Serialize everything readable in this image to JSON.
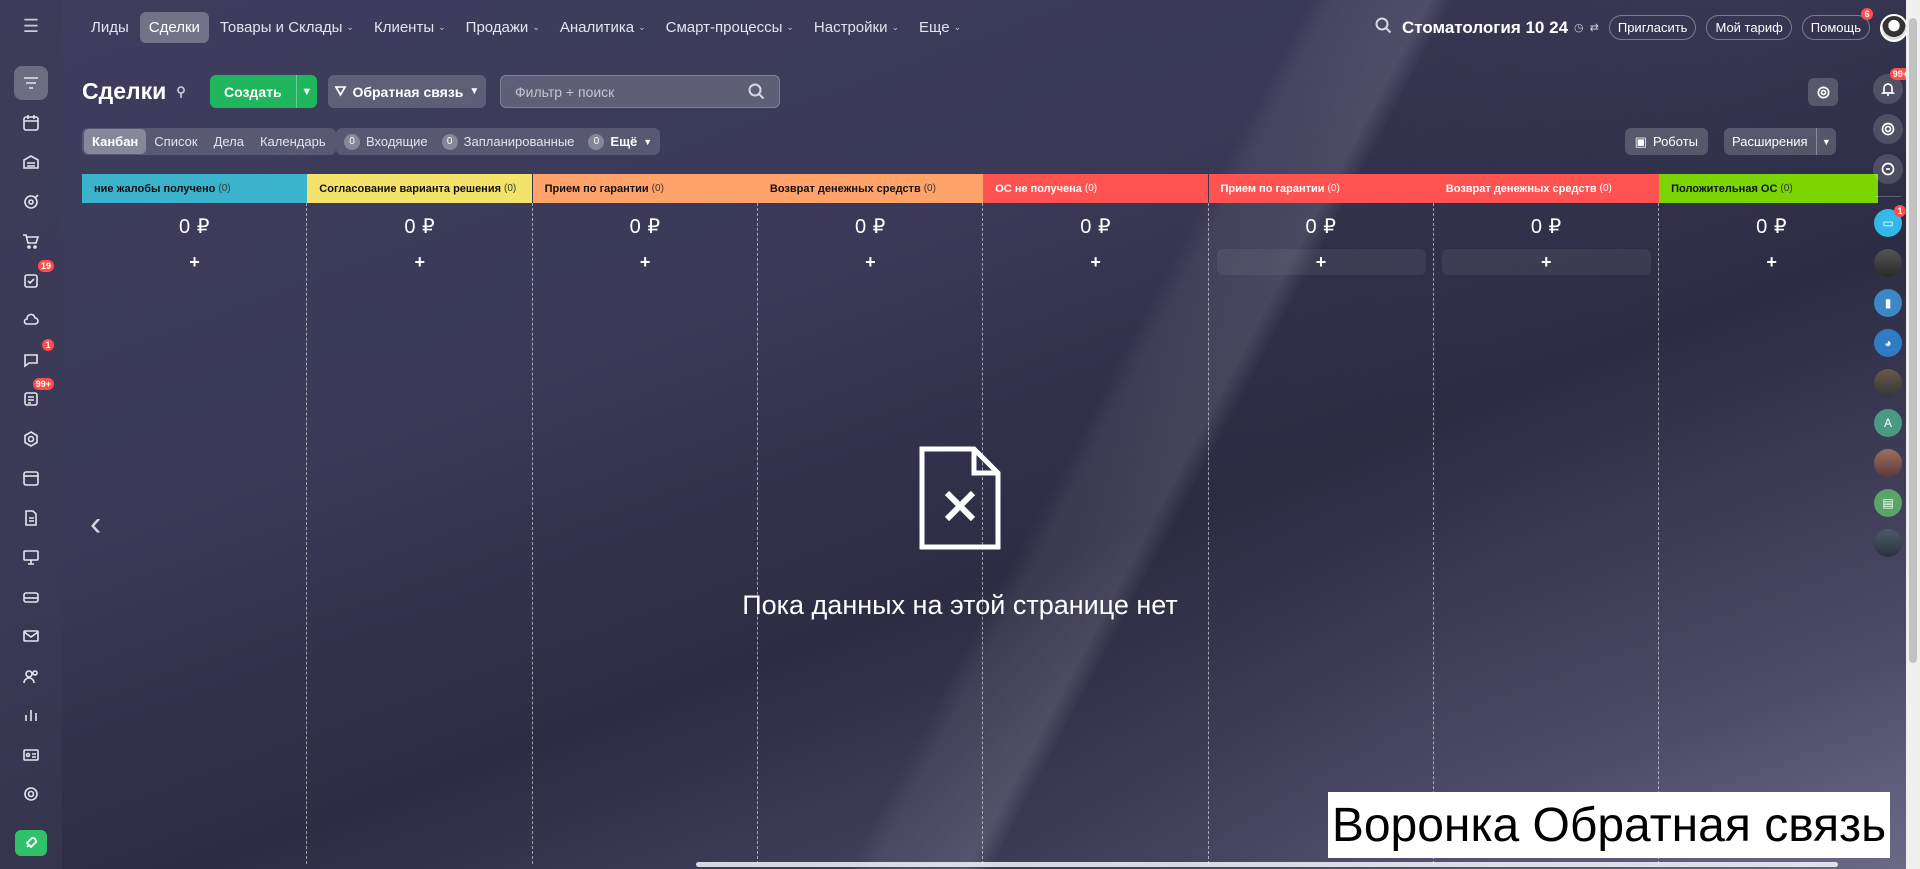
{
  "nav": {
    "items": [
      {
        "label": "Лиды",
        "has_menu": false,
        "active": false
      },
      {
        "label": "Сделки",
        "has_menu": false,
        "active": true
      },
      {
        "label": "Товары и Склады",
        "has_menu": true,
        "active": false
      },
      {
        "label": "Клиенты",
        "has_menu": true,
        "active": false
      },
      {
        "label": "Продажи",
        "has_menu": true,
        "active": false
      },
      {
        "label": "Аналитика",
        "has_menu": true,
        "active": false
      },
      {
        "label": "Смарт-процессы",
        "has_menu": true,
        "active": false
      },
      {
        "label": "Настройки",
        "has_menu": true,
        "active": false
      },
      {
        "label": "Еще",
        "has_menu": true,
        "active": false
      }
    ],
    "company": "Стоматология 10 24",
    "invite_label": "Пригласить",
    "tariff_label": "Мой тариф",
    "help_label": "Помощь",
    "help_badge": "6"
  },
  "left_sidebar": {
    "badges": {
      "tasks": "19",
      "chat": "1",
      "feed": "99+"
    }
  },
  "toolbar": {
    "title": "Сделки",
    "create_label": "Создать",
    "funnel_label": "Обратная связь",
    "filter_placeholder": "Фильтр + поиск"
  },
  "views": {
    "tabs": [
      "Канбан",
      "Список",
      "Дела",
      "Календарь"
    ],
    "active": "Канбан",
    "counters": [
      {
        "num": "0",
        "label": "Входящие"
      },
      {
        "num": "0",
        "label": "Запланированные"
      },
      {
        "num": "0",
        "label": "Ещё"
      }
    ],
    "robots_label": "Роботы",
    "extensions_label": "Расширения"
  },
  "stages": [
    {
      "name": "ние жалобы получено",
      "count": "(0)",
      "sum": "0 ₽",
      "color": "#3bb3cc"
    },
    {
      "name": "Согласование варианта решения",
      "count": "(0)",
      "sum": "0 ₽",
      "color": "#f4e36a"
    },
    {
      "name": "Прием по гарантии",
      "count": "(0)",
      "sum": "0 ₽",
      "color": "#ffa36b"
    },
    {
      "name": "Возврат денежных средств",
      "count": "(0)",
      "sum": "0 ₽",
      "color": "#ffa36b"
    },
    {
      "name": "ОС не получена",
      "count": "(0)",
      "sum": "0 ₽",
      "color": "#ff5352"
    },
    {
      "name": "Прием по гарантии",
      "count": "(0)",
      "sum": "0 ₽",
      "color": "#ff5352"
    },
    {
      "name": "Возврат денежных средств",
      "count": "(0)",
      "sum": "0 ₽",
      "color": "#ff5352"
    },
    {
      "name": "Положительная ОС",
      "count": "(0)",
      "sum": "0 ₽",
      "color": "#7bd500"
    }
  ],
  "empty_state": {
    "text": "Пока данных на этой странице нет"
  },
  "right_sidebar": {
    "notifications_badge": "99+",
    "chat_badge": "1",
    "avatar_letter": "A"
  },
  "caption": "Воронка Обратная связь"
}
